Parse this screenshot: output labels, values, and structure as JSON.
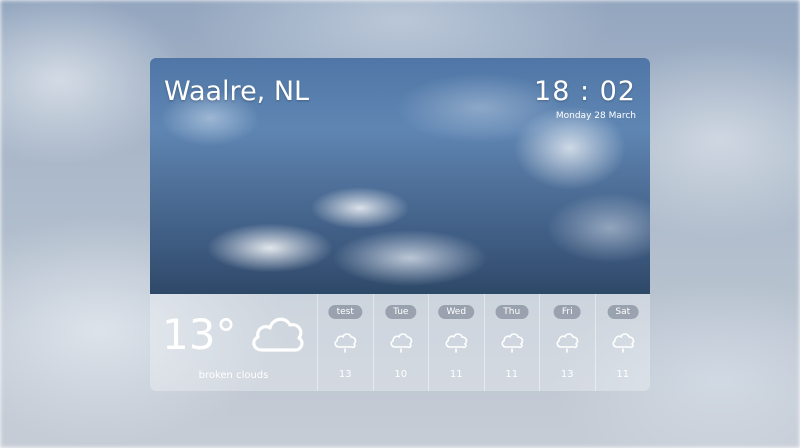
{
  "location": "Waalre, NL",
  "time": "18 : 02",
  "date": "Monday 28 March",
  "current": {
    "temperature": "13°",
    "description": "broken clouds",
    "icon": "cloud-icon"
  },
  "forecast": [
    {
      "day": "test",
      "temp": "13",
      "icon": "rain-cloud-icon"
    },
    {
      "day": "Tue",
      "temp": "10",
      "icon": "rain-cloud-icon"
    },
    {
      "day": "Wed",
      "temp": "11",
      "icon": "rain-cloud-icon"
    },
    {
      "day": "Thu",
      "temp": "11",
      "icon": "rain-cloud-icon"
    },
    {
      "day": "Fri",
      "temp": "13",
      "icon": "rain-cloud-icon"
    },
    {
      "day": "Sat",
      "temp": "11",
      "icon": "rain-cloud-icon"
    }
  ],
  "colors": {
    "text": "#ffffff",
    "panel": "rgba(255,255,255,0.30)",
    "pill": "rgba(110,120,135,0.55)"
  }
}
